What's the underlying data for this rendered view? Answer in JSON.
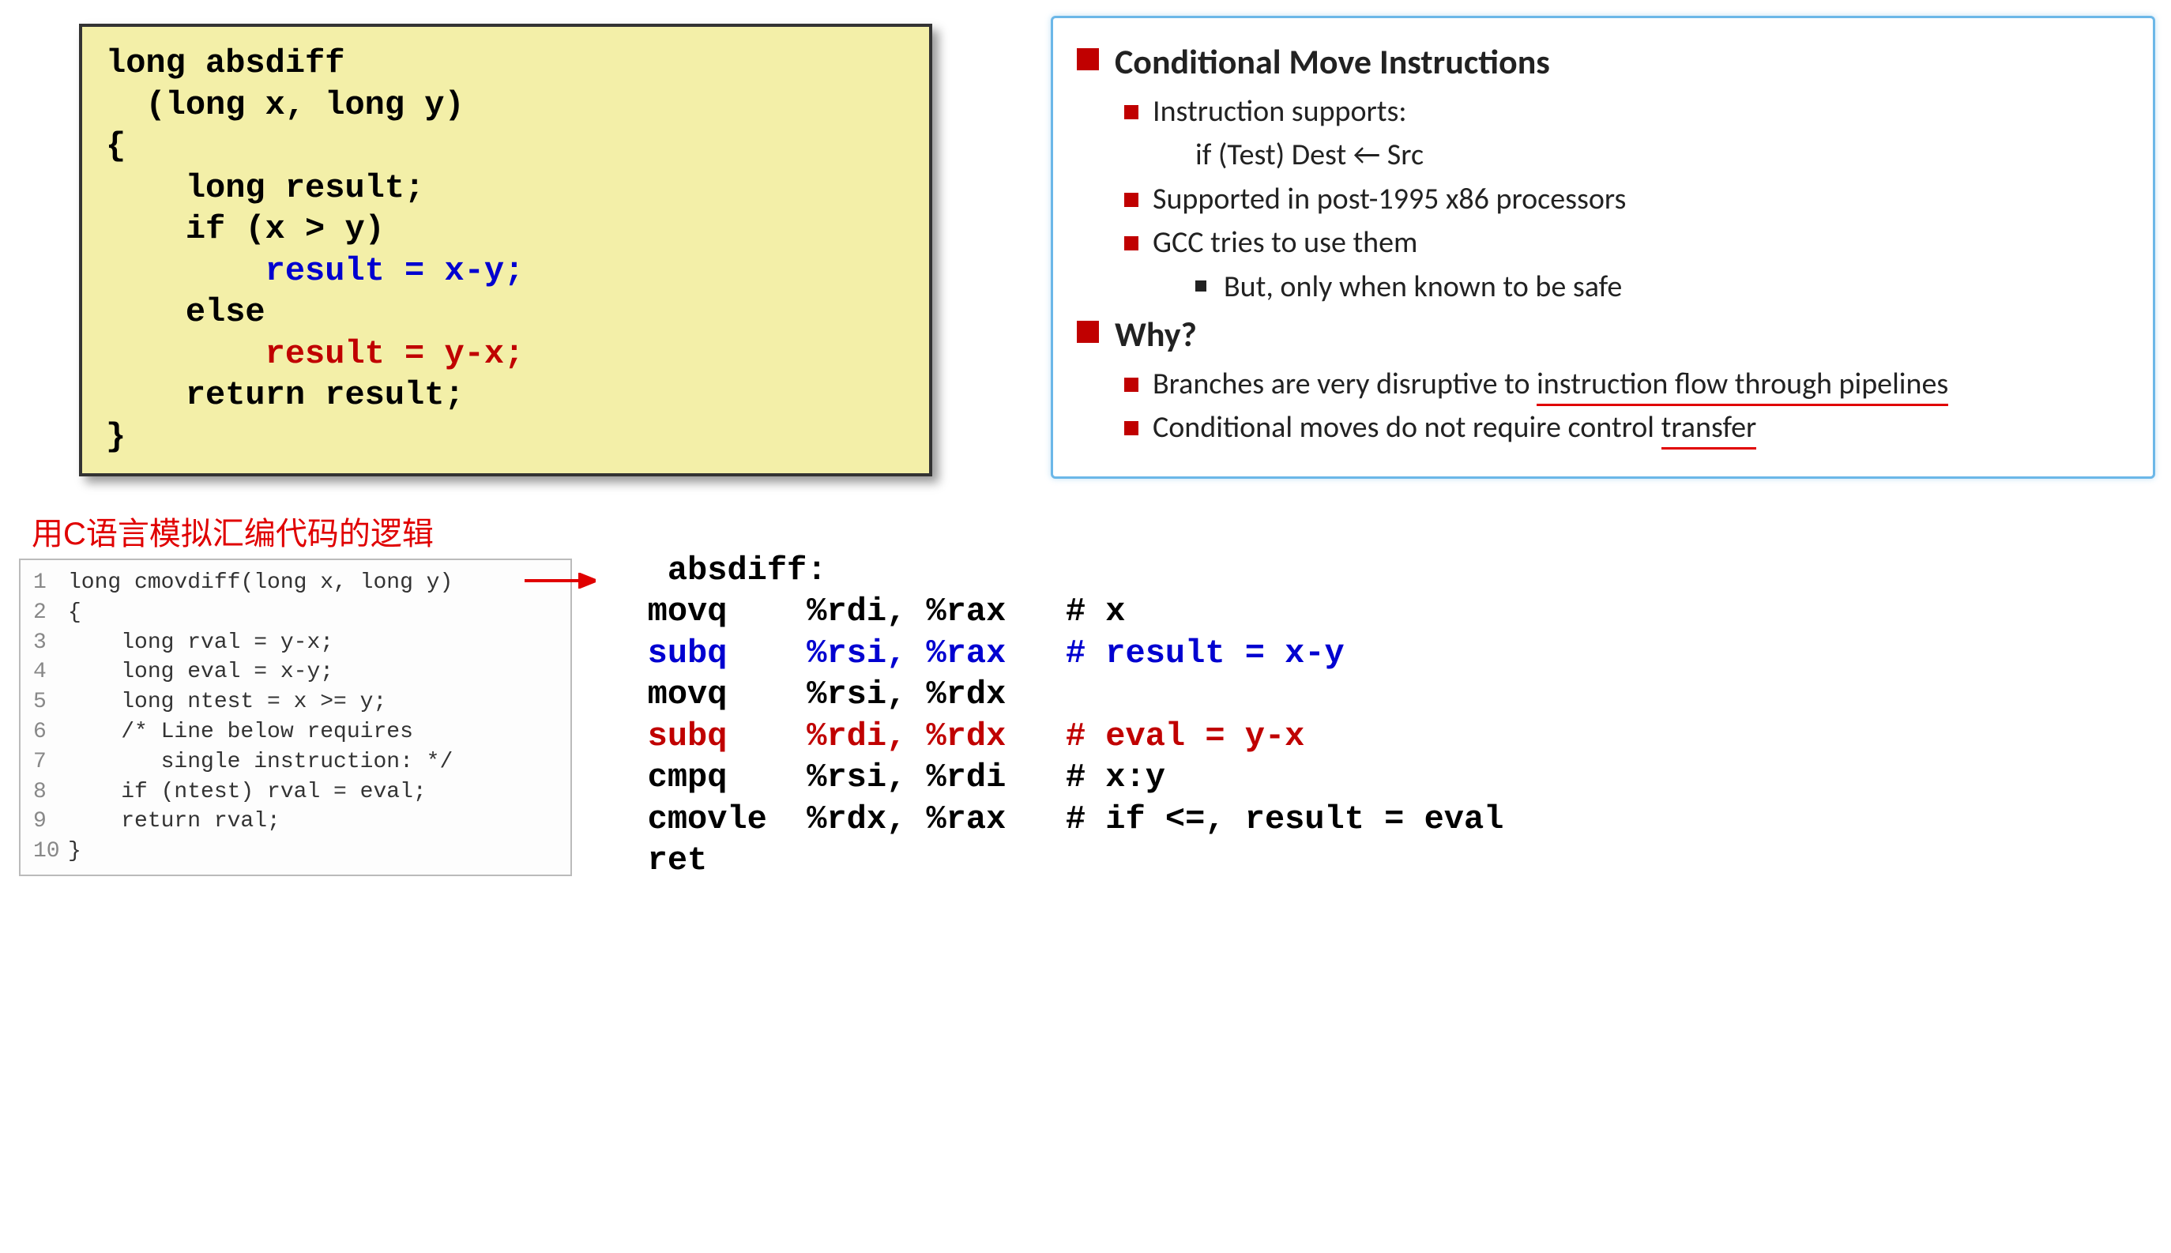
{
  "c_code": {
    "l1": "long absdiff",
    "l2": "  (long x, long y)",
    "l3": "{",
    "l4": "    long result;",
    "l5": "    if (x > y)",
    "l6": "        result = x-y;",
    "l7": "    else",
    "l8": "        result = y-x;",
    "l9": "    return result;",
    "l10": "}"
  },
  "info": {
    "title1": "Conditional Move Instructions",
    "b1a": "Instruction supports:",
    "b1a_sub": "if (Test) Dest ← Src",
    "b1b": "Supported in post-1995 x86 processors",
    "b1c": "GCC tries to use them",
    "b1c_sub": "But, only when known to be safe",
    "title2": "Why?",
    "b2a_pre": "Branches are very disruptive to ",
    "b2a_u": "instruction flow through pipelines",
    "b2b_pre": "Conditional moves do not require control ",
    "b2b_u": "transfer"
  },
  "annotation": "用C语言模拟汇编代码的逻辑",
  "cmov": {
    "lines": [
      {
        "n": "1",
        "t": "long cmovdiff(long x, long y)"
      },
      {
        "n": "2",
        "t": "{"
      },
      {
        "n": "3",
        "t": "    long rval = y-x;"
      },
      {
        "n": "4",
        "t": "    long eval = x-y;"
      },
      {
        "n": "5",
        "t": "    long ntest = x >= y;"
      },
      {
        "n": "6",
        "t": "    /* Line below requires"
      },
      {
        "n": "7",
        "t": "       single instruction: */"
      },
      {
        "n": "8",
        "t": "    if (ntest) rval = eval;"
      },
      {
        "n": "9",
        "t": "    return rval;"
      },
      {
        "n": "10",
        "t": "}"
      }
    ]
  },
  "asm": {
    "label": "absdiff:",
    "l1": "   movq    %rdi, %rax   # x",
    "l2": "   subq    %rsi, %rax   # result = x-y",
    "l3": "   movq    %rsi, %rdx",
    "l4": "   subq    %rdi, %rdx   # eval = y-x",
    "l5": "   cmpq    %rsi, %rdi   # x:y",
    "l6": "   cmovle  %rdx, %rax   # if <=, result = eval",
    "l7": "   ret"
  }
}
